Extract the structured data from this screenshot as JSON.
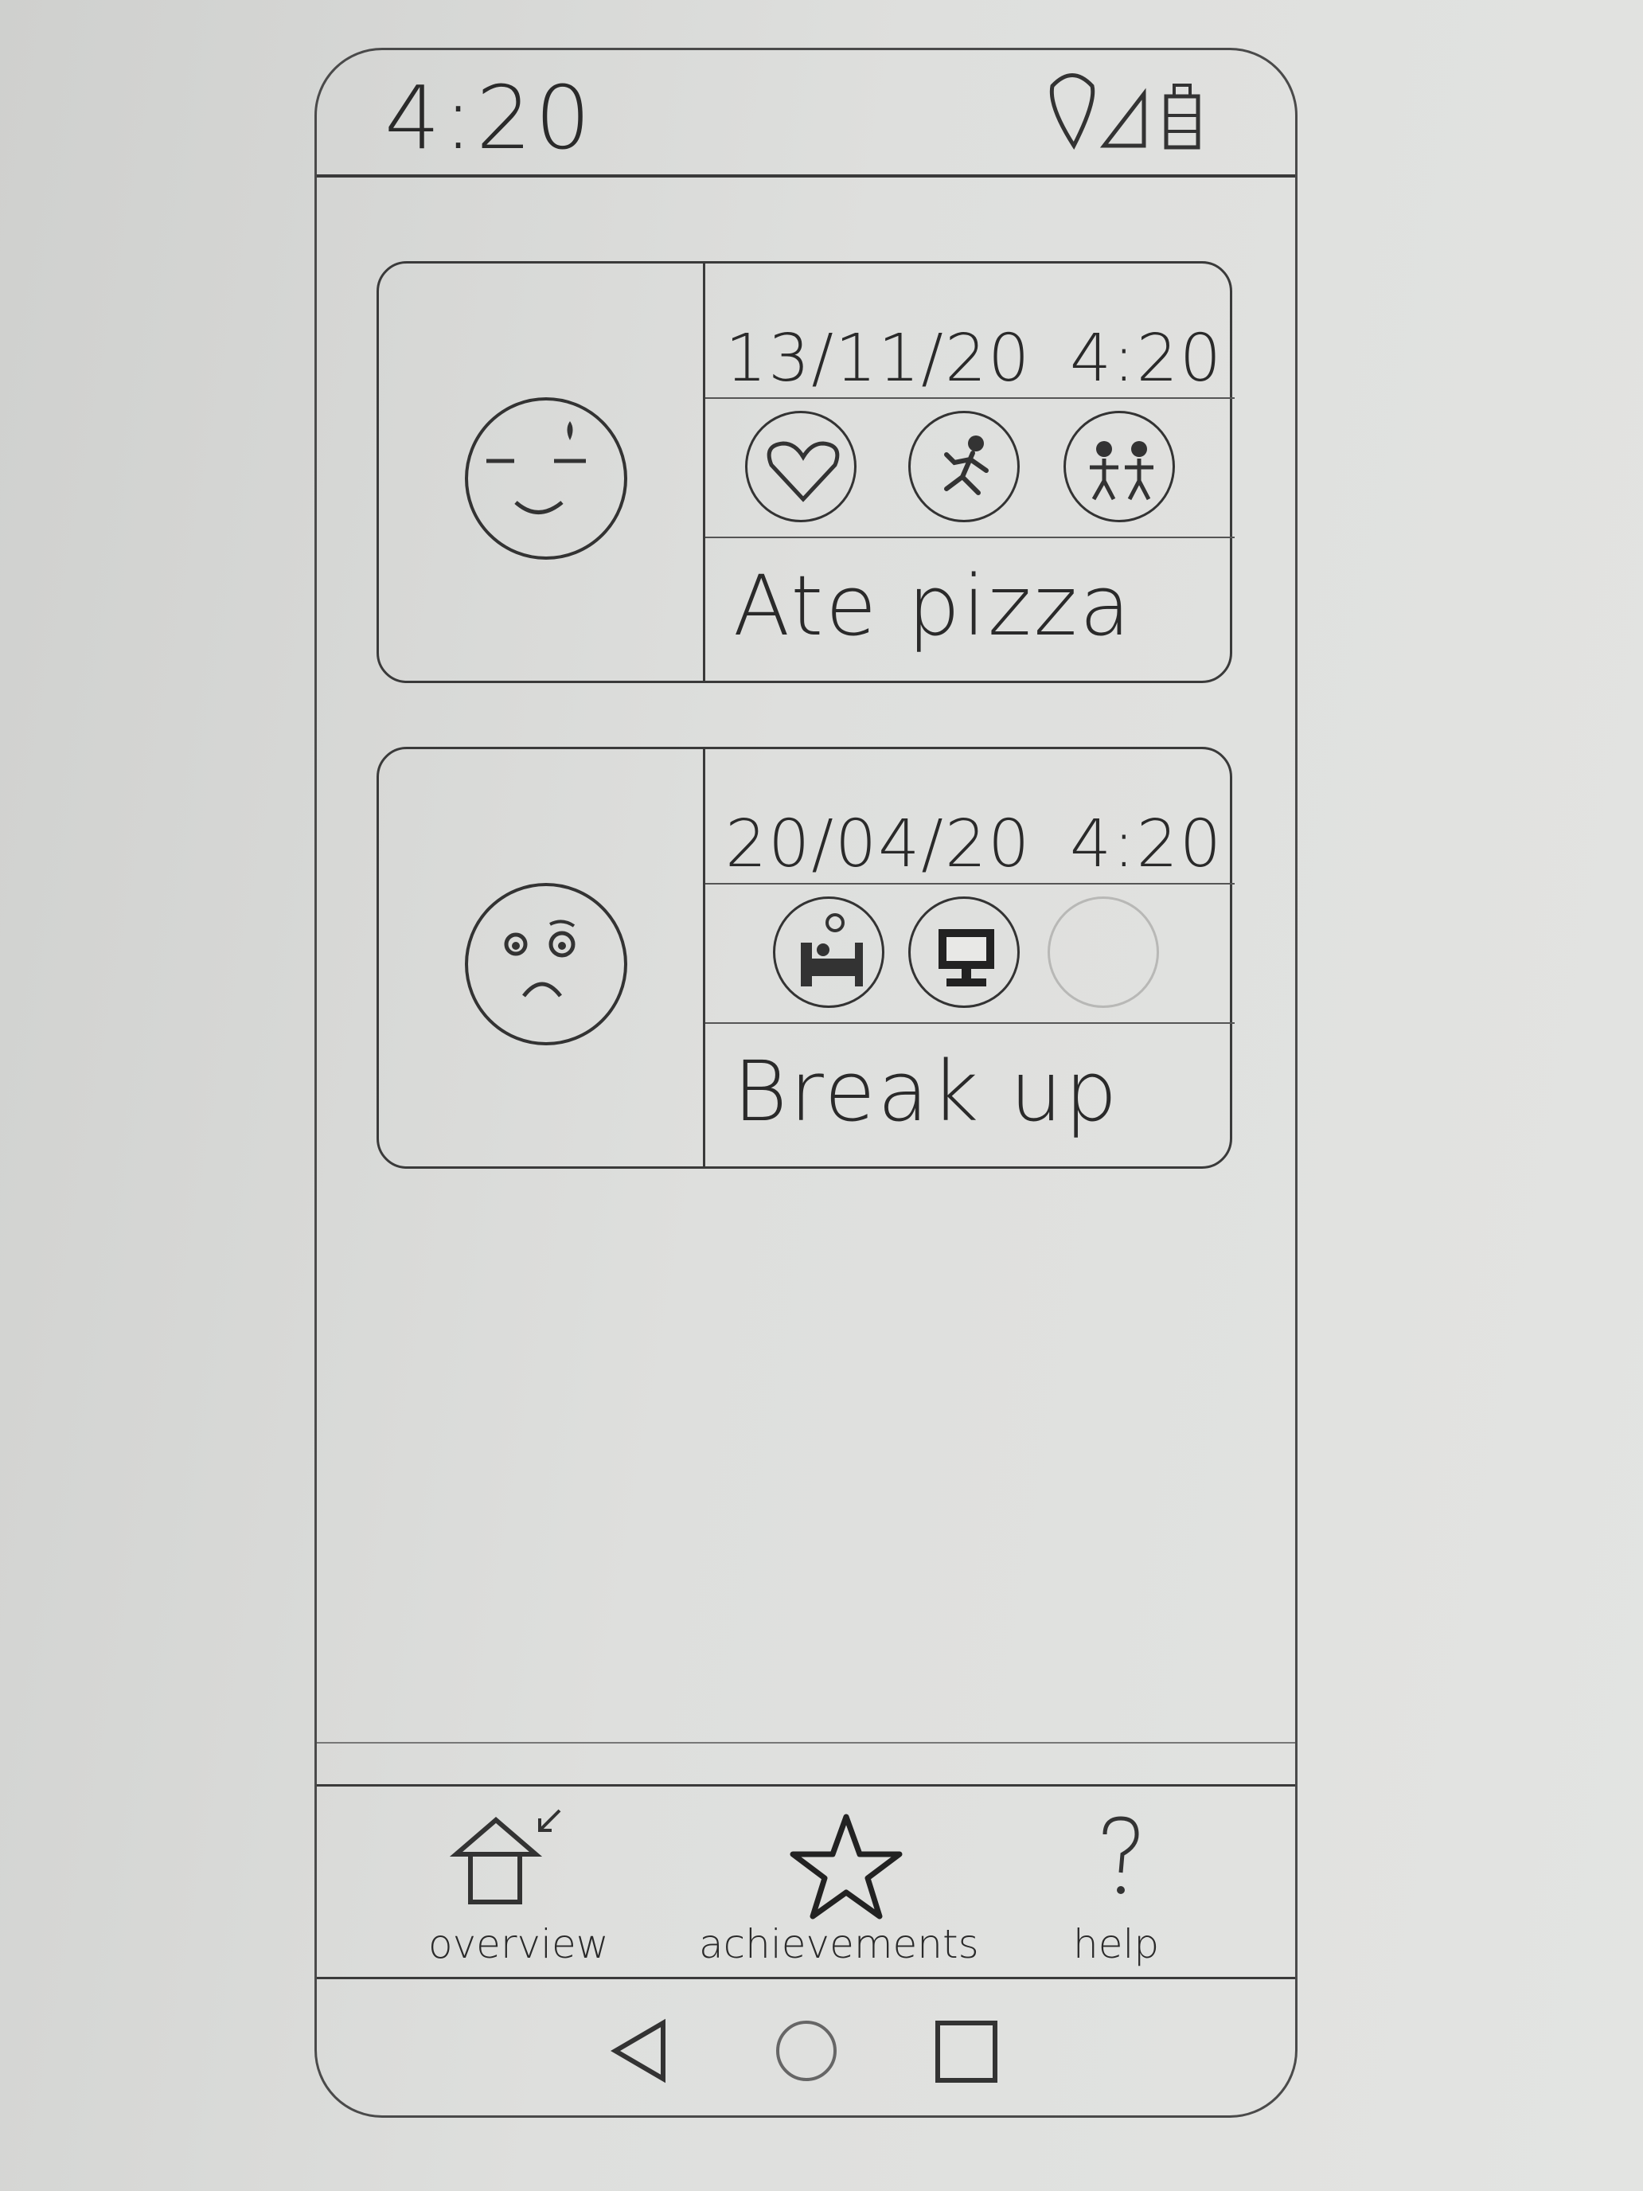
{
  "status_bar": {
    "time": "4:20",
    "icons": [
      "location-icon",
      "signal-icon",
      "battery-icon"
    ]
  },
  "entries": [
    {
      "date": "13/11/20",
      "time": "4:20",
      "mood": "happy-face-icon",
      "activities": [
        "heart-icon",
        "running-icon",
        "friends-icon"
      ],
      "note": "Ate pizza"
    },
    {
      "date": "20/04/20",
      "time": "4:20",
      "mood": "sad-face-icon",
      "activities": [
        "sleep-icon",
        "computer-icon",
        "empty-slot"
      ],
      "note": "Break up"
    }
  ],
  "bottom_nav": [
    {
      "label": "overview",
      "icon": "house-icon",
      "active": true
    },
    {
      "label": "achievements",
      "icon": "star-icon"
    },
    {
      "label": "help",
      "icon": "question-icon"
    }
  ],
  "system_nav": [
    "back-icon",
    "home-icon",
    "recents-icon"
  ]
}
